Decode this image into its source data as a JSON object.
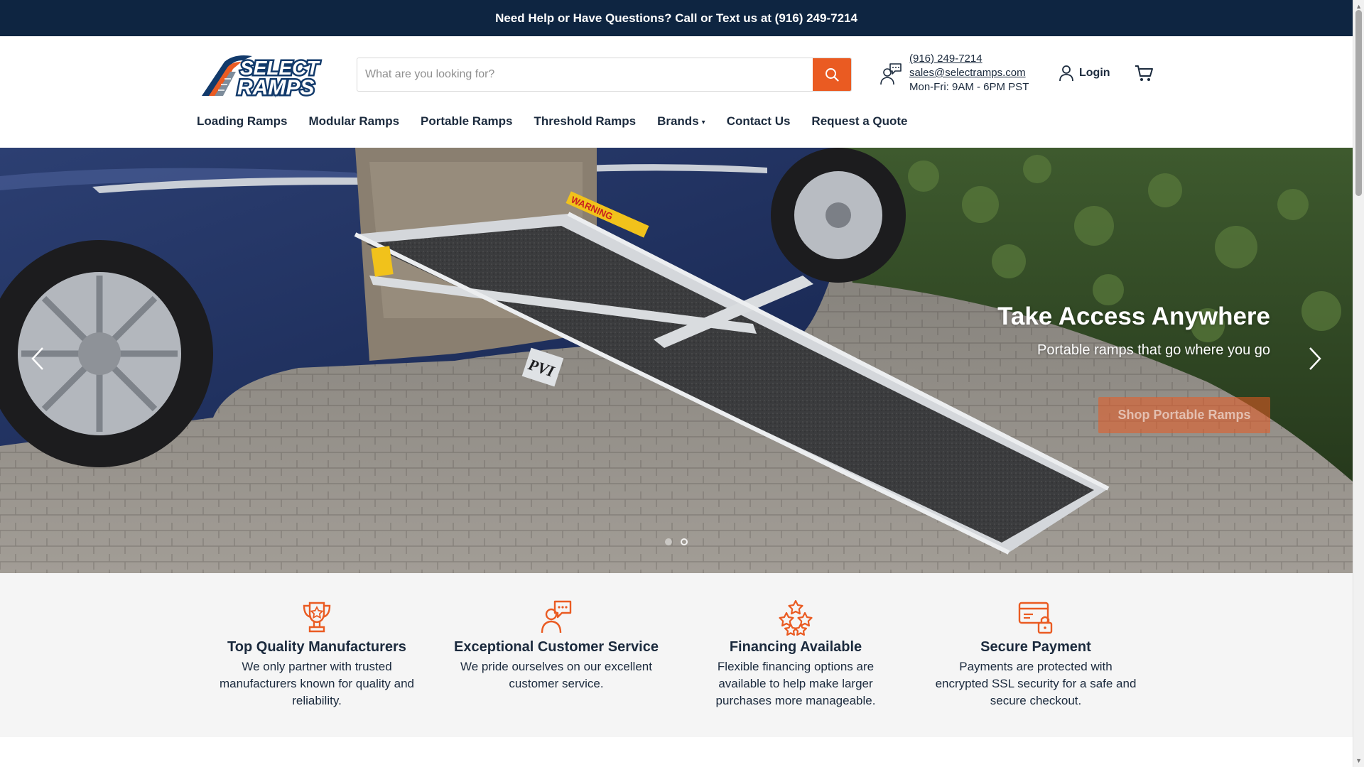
{
  "announcement": {
    "text": "Need Help or Have Questions? Call or Text us at (916) 249-7214"
  },
  "header": {
    "logo_alt": "SELECT RAMPS",
    "logo_line1": "SELECT",
    "logo_line2": "RAMPS",
    "search": {
      "placeholder": "What are you looking for?"
    },
    "contact": {
      "phone": "(916) 249-7214",
      "email": "sales@selectramps.com",
      "hours": "Mon-Fri: 9AM - 6PM PST"
    },
    "login_label": "Login"
  },
  "nav": {
    "items": [
      {
        "label": "Loading Ramps"
      },
      {
        "label": "Modular Ramps"
      },
      {
        "label": "Portable Ramps"
      },
      {
        "label": "Threshold Ramps"
      },
      {
        "label": "Brands"
      },
      {
        "label": "Contact Us"
      },
      {
        "label": "Request a Quote"
      }
    ]
  },
  "hero": {
    "title": "Take Access Anywhere",
    "subtitle": "Portable ramps that go where you go",
    "button_label": "Shop Portable Ramps",
    "ramp_warning": "WARNING",
    "ramp_brand": "PVI",
    "slides": 2,
    "active_slide": 2
  },
  "features": [
    {
      "title": "Top Quality Manufacturers",
      "text": "We only partner with trusted manufacturers known for quality and reliability."
    },
    {
      "title": "Exceptional Customer Service",
      "text": "We pride ourselves on our excellent customer service."
    },
    {
      "title": "Financing Available",
      "text": "Flexible financing options are available to help make larger purchases more manageable."
    },
    {
      "title": "Secure Payment",
      "text": "Payments are protected with encrypted SSL security for a safe and secure checkout."
    }
  ],
  "colors": {
    "navy": "#0e2541",
    "accent": "#ea5b22",
    "text": "#1b2a3d",
    "feature_bg": "#f5f5f5"
  },
  "icons": [
    "search-icon",
    "support-agent-icon",
    "user-icon",
    "cart-icon",
    "chevron-left-icon",
    "chevron-right-icon",
    "trophy-icon",
    "chat-agent-icon",
    "stars-icon",
    "secure-card-icon"
  ]
}
